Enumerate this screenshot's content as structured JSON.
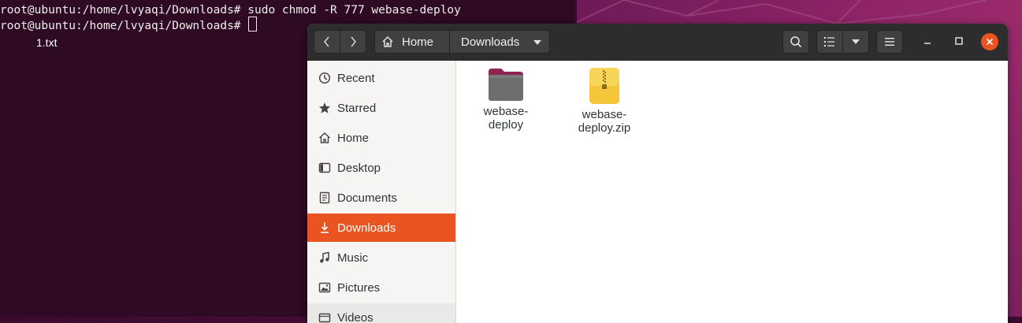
{
  "terminal": {
    "line1": "root@ubuntu:/home/lvyaqi/Downloads# sudo chmod -R 777 webase-deploy",
    "line2_prompt": "root@ubuntu:/home/lvyaqi/Downloads# "
  },
  "desktop": {
    "file_label": "1.txt"
  },
  "files": {
    "path": {
      "home_label": "Home",
      "current_label": "Downloads"
    },
    "sidebar": [
      {
        "label": "Recent",
        "icon": "clock-icon"
      },
      {
        "label": "Starred",
        "icon": "star-icon"
      },
      {
        "label": "Home",
        "icon": "home-icon"
      },
      {
        "label": "Desktop",
        "icon": "desktop-icon"
      },
      {
        "label": "Documents",
        "icon": "document-icon"
      },
      {
        "label": "Downloads",
        "icon": "download-icon",
        "active": true
      },
      {
        "label": "Music",
        "icon": "music-icon"
      },
      {
        "label": "Pictures",
        "icon": "picture-icon"
      },
      {
        "label": "Videos",
        "icon": "video-icon"
      }
    ],
    "items": [
      {
        "name_line1": "webase-",
        "name_line2": "deploy",
        "type": "folder"
      },
      {
        "name_line1": "webase-",
        "name_line2": "deploy.zip",
        "type": "zip"
      }
    ]
  },
  "colors": {
    "accent": "#e95420",
    "headerbar": "#2d2d2d",
    "terminal_bg": "#2f0a24"
  }
}
